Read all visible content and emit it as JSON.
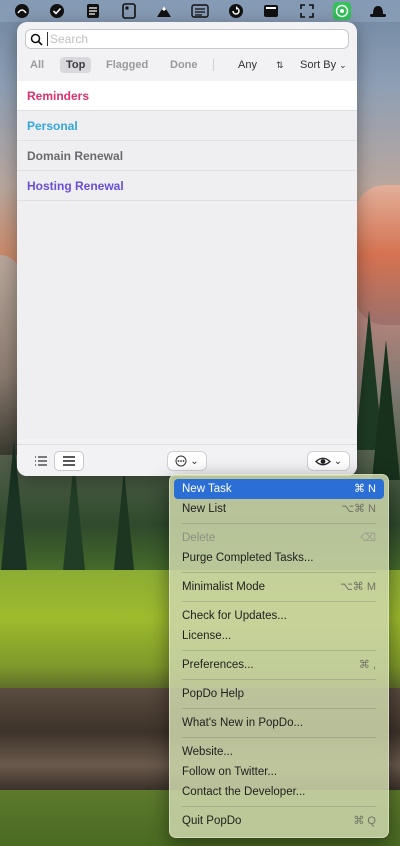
{
  "menubar": {
    "icons": [
      "finder-circle-icon",
      "checkmark-circle-icon",
      "note-stack-icon",
      "tablet-icon",
      "mountain-icon",
      "list-window-icon",
      "refresh-circle-icon",
      "terminal-icon",
      "expand-icon",
      "whatsapp-icon",
      "hat-icon"
    ]
  },
  "search": {
    "placeholder": "Search",
    "value": ""
  },
  "filters": {
    "tabs": [
      "All",
      "Top",
      "Flagged",
      "Done"
    ],
    "selected": "Top",
    "priority_label": "Any",
    "sort_label": "Sort By"
  },
  "lists": [
    {
      "label": "Reminders",
      "color": "#e0306e"
    },
    {
      "label": "Personal",
      "color": "#35a7e0"
    },
    {
      "label": "Domain Renewal",
      "color": "#6b6b6f"
    },
    {
      "label": "Hosting Renewal",
      "color": "#6a4fd6"
    }
  ],
  "menu": {
    "items": [
      {
        "label": "New Task",
        "shortcut": "⌘ N"
      },
      {
        "label": "New List",
        "shortcut": "⌥⌘ N"
      },
      {
        "label": "Delete",
        "shortcut": "⌫"
      },
      {
        "label": "Purge Completed Tasks...",
        "shortcut": ""
      },
      {
        "label": "Minimalist Mode",
        "shortcut": "⌥⌘ M"
      },
      {
        "label": "Check for Updates...",
        "shortcut": ""
      },
      {
        "label": "License...",
        "shortcut": ""
      },
      {
        "label": "Preferences...",
        "shortcut": "⌘ ,"
      },
      {
        "label": "PopDo Help",
        "shortcut": ""
      },
      {
        "label": "What's New in PopDo...",
        "shortcut": ""
      },
      {
        "label": "Website...",
        "shortcut": ""
      },
      {
        "label": "Follow on Twitter...",
        "shortcut": ""
      },
      {
        "label": "Contact the Developer...",
        "shortcut": ""
      },
      {
        "label": "Quit PopDo",
        "shortcut": "⌘ Q"
      }
    ],
    "highlighted": "New Task",
    "disabled": [
      "Delete"
    ],
    "accent_color": "#2b6fd6"
  }
}
